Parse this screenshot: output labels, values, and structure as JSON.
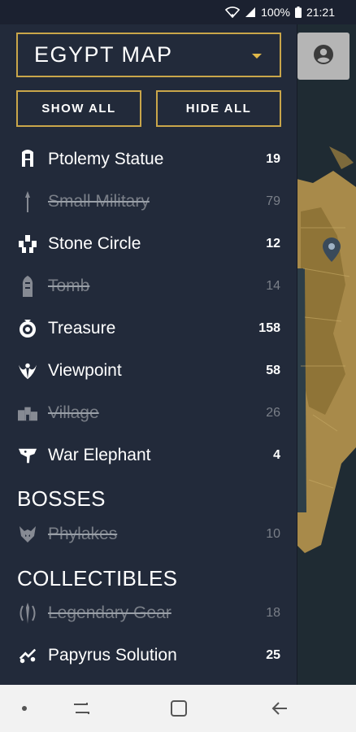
{
  "status_bar": {
    "battery": "100%",
    "time": "21:21"
  },
  "drawer": {
    "map_title": "EGYPT MAP",
    "show_all_label": "SHOW ALL",
    "hide_all_label": "HIDE ALL",
    "categories": [
      {
        "label": "Ptolemy Statue",
        "count": "19",
        "enabled": true,
        "icon": "ptolemy-statue-icon"
      },
      {
        "label": "Small Military",
        "count": "79",
        "enabled": false,
        "icon": "small-military-icon"
      },
      {
        "label": "Stone Circle",
        "count": "12",
        "enabled": true,
        "icon": "stone-circle-icon"
      },
      {
        "label": "Tomb",
        "count": "14",
        "enabled": false,
        "icon": "tomb-icon"
      },
      {
        "label": "Treasure",
        "count": "158",
        "enabled": true,
        "icon": "treasure-icon"
      },
      {
        "label": "Viewpoint",
        "count": "58",
        "enabled": true,
        "icon": "viewpoint-icon"
      },
      {
        "label": "Village",
        "count": "26",
        "enabled": false,
        "icon": "village-icon"
      },
      {
        "label": "War Elephant",
        "count": "4",
        "enabled": true,
        "icon": "war-elephant-icon"
      }
    ],
    "bosses_heading": "BOSSES",
    "bosses": [
      {
        "label": "Phylakes",
        "count": "10",
        "enabled": false,
        "icon": "phylakes-icon"
      }
    ],
    "collectibles_heading": "COLLECTIBLES",
    "collectibles": [
      {
        "label": "Legendary Gear",
        "count": "18",
        "enabled": false,
        "icon": "legendary-gear-icon"
      },
      {
        "label": "Papyrus Solution",
        "count": "25",
        "enabled": true,
        "icon": "papyrus-solution-icon"
      }
    ]
  },
  "colors": {
    "accent_gold": "#c9a64a",
    "drawer_bg": "#222a3a",
    "disabled_text": "#7a7f88"
  }
}
